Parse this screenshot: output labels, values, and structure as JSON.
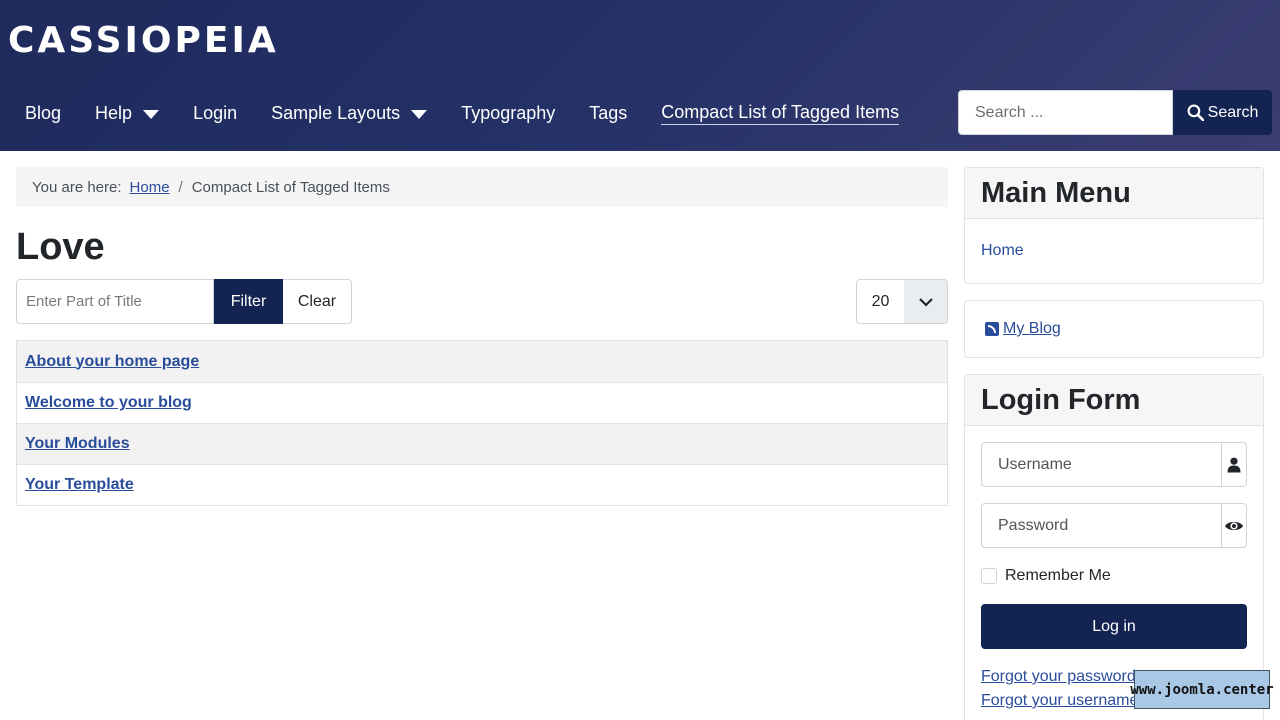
{
  "site": {
    "brand": "CASSIOPEIA"
  },
  "nav": {
    "items": [
      {
        "label": "Blog"
      },
      {
        "label": "Help",
        "dropdown": true
      },
      {
        "label": "Login"
      },
      {
        "label": "Sample Layouts",
        "dropdown": true
      },
      {
        "label": "Typography"
      },
      {
        "label": "Tags"
      },
      {
        "label": "Compact List of Tagged Items",
        "active": true
      }
    ]
  },
  "search": {
    "placeholder": "Search ...",
    "button_label": "Search"
  },
  "breadcrumb": {
    "prefix": "You are here:",
    "home": "Home",
    "current": "Compact List of Tagged Items"
  },
  "page": {
    "title": "Love"
  },
  "filter": {
    "placeholder": "Enter Part of Title",
    "filter_label": "Filter",
    "clear_label": "Clear",
    "limit_value": "20"
  },
  "items": [
    {
      "title": "About your home page"
    },
    {
      "title": "Welcome to your blog"
    },
    {
      "title": "Your Modules"
    },
    {
      "title": "Your Template"
    }
  ],
  "main_menu": {
    "title": "Main Menu",
    "home": "Home"
  },
  "blog_module": {
    "link": "My Blog"
  },
  "login_form": {
    "title": "Login Form",
    "username_placeholder": "Username",
    "password_placeholder": "Password",
    "remember_label": "Remember Me",
    "login_button": "Log in",
    "forgot_password": "Forgot your password?",
    "forgot_username": "Forgot your username?"
  },
  "watermark": {
    "text": "www.joomla.center"
  },
  "colors": {
    "header_start": "#1f2a5c",
    "header_end": "#3b3d72",
    "button_dark": "#142452",
    "link": "#2a4d9b"
  }
}
